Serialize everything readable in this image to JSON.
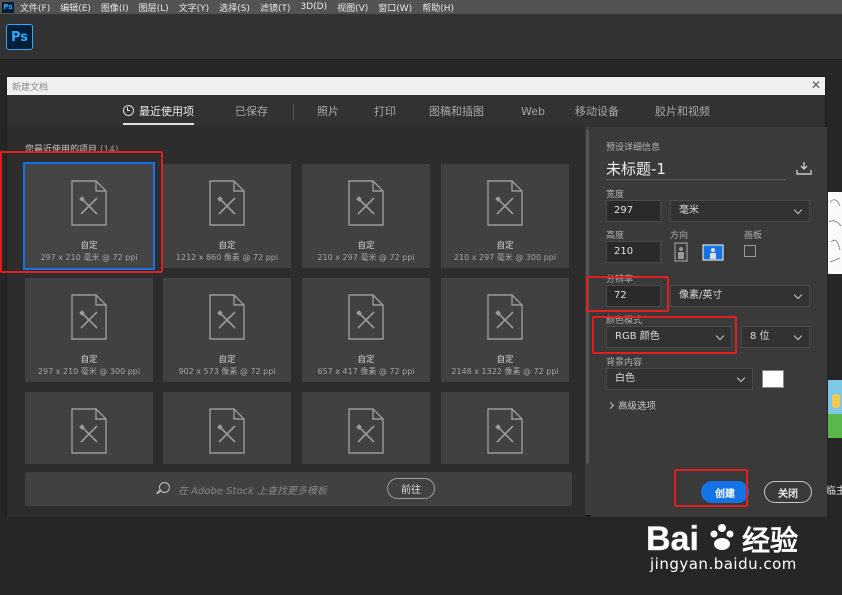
{
  "menubar": {
    "logo": "Ps",
    "items": [
      "文件(F)",
      "编辑(E)",
      "图像(I)",
      "图层(L)",
      "文字(Y)",
      "选择(S)",
      "滤镜(T)",
      "3D(D)",
      "视图(V)",
      "窗口(W)",
      "帮助(H)"
    ]
  },
  "app": {
    "logo": "Ps"
  },
  "dialog": {
    "title": "新建文档",
    "close_icon": "close-icon",
    "tabs": [
      "最近使用项",
      "已保存",
      "照片",
      "打印",
      "图稿和插图",
      "Web",
      "移动设备",
      "胶片和视频"
    ],
    "active_tab": 0,
    "recent": {
      "label": "您最近使用的项目",
      "count": "(14)",
      "tiles": [
        {
          "name": "自定",
          "dims": "297 x 210 毫米 @ 72 ppi",
          "selected": true
        },
        {
          "name": "自定",
          "dims": "1212 x 860 像素 @ 72 ppi"
        },
        {
          "name": "自定",
          "dims": "210 x 297 毫米 @ 72 ppi"
        },
        {
          "name": "自定",
          "dims": "210 x 297 毫米 @ 300 ppi"
        },
        {
          "name": "自定",
          "dims": "297 x 210 毫米 @ 300 ppi"
        },
        {
          "name": "自定",
          "dims": "902 x 573 像素 @ 72 ppi"
        },
        {
          "name": "自定",
          "dims": "657 x 417 像素 @ 72 ppi"
        },
        {
          "name": "自定",
          "dims": "2148 x 1322 像素 @ 72 ppi"
        },
        {
          "name": "",
          "dims": ""
        },
        {
          "name": "",
          "dims": ""
        },
        {
          "name": "",
          "dims": ""
        },
        {
          "name": "",
          "dims": ""
        }
      ]
    },
    "search": {
      "placeholder": "在 Adobe Stock 上查找更多模板",
      "go_label": "前往"
    },
    "details": {
      "title": "预设详细信息",
      "doc_name": "未标题-1",
      "width_label": "宽度",
      "width_value": "297",
      "width_unit": "毫米",
      "height_label": "高度",
      "height_value": "210",
      "orientation_label": "方向",
      "artboard_label": "画板",
      "resolution_label": "分辨率",
      "resolution_value": "72",
      "resolution_unit": "像素/英寸",
      "color_mode_label": "颜色模式",
      "color_mode_value": "RGB 颜色",
      "bit_depth": "8 位",
      "background_label": "背景内容",
      "background_value": "白色",
      "background_color": "#ffffff",
      "advanced_label": "高级选项",
      "create_label": "创建",
      "close_label": "关闭"
    }
  },
  "colors": {
    "accent": "#1473e6",
    "annotation": "#e02020"
  },
  "watermark": {
    "brand": "Bai",
    "brand_cn": "经验",
    "url": "jingyan.baidu.com"
  },
  "side_text": "临主"
}
